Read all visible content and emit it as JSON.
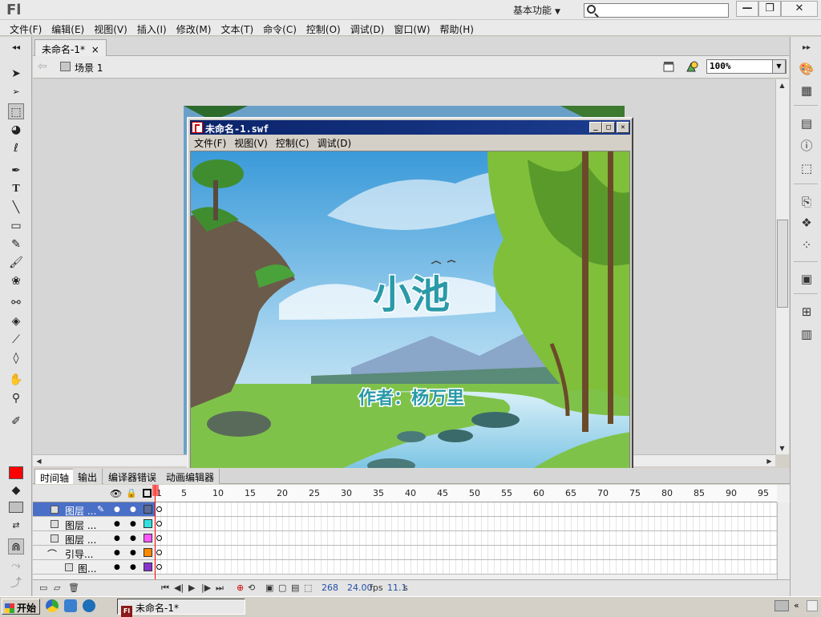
{
  "app": {
    "logo": "Fl",
    "workspace": "基本功能",
    "search_placeholder": ""
  },
  "window_buttons": {
    "minimize": "—",
    "restore": "❐",
    "close": "✕"
  },
  "menu": [
    "文件(F)",
    "编辑(E)",
    "视图(V)",
    "插入(I)",
    "修改(M)",
    "文本(T)",
    "命令(C)",
    "控制(O)",
    "调试(D)",
    "窗口(W)",
    "帮助(H)"
  ],
  "document": {
    "tab": "未命名-1*",
    "tab_close": "×",
    "scene": "场景 1",
    "zoom": "100%"
  },
  "swf_window": {
    "title": "未命名-1.swf",
    "menu": [
      "文件(F)",
      "视图(V)",
      "控制(C)",
      "调试(D)"
    ],
    "buttons": {
      "minimize": "_",
      "maximize": "□",
      "close": "✕"
    },
    "heading": "小池",
    "author": "作者：杨万里"
  },
  "panel_tabs": [
    "时间轴",
    "输出",
    "编译器错误",
    "动画编辑器"
  ],
  "timeline": {
    "frame_numbers": [
      "1",
      "5",
      "10",
      "15",
      "20",
      "25",
      "30",
      "35",
      "40",
      "45",
      "50",
      "55",
      "60",
      "65",
      "70",
      "75",
      "80",
      "85",
      "90",
      "95"
    ],
    "layers": [
      {
        "name": "图层 ...",
        "color": "#5a6a9a",
        "selected": true
      },
      {
        "name": "图层 ...",
        "color": "#33e0e0",
        "selected": false
      },
      {
        "name": "图层 ...",
        "color": "#ff55ff",
        "selected": false
      },
      {
        "name": "引导...",
        "color": "#ff8800",
        "selected": false
      },
      {
        "name": "图...",
        "color": "#8833cc",
        "selected": false
      }
    ],
    "status": {
      "frame": "268",
      "fps": "24.00",
      "fps_unit": "fps",
      "time": "11.1",
      "time_unit": "s"
    }
  },
  "taskbar": {
    "start": "开始",
    "task": "未命名-1*"
  },
  "colors": {
    "stroke": "#ff0000",
    "selected_layer": "#4a6fc7",
    "swf_title": "#0a246a"
  }
}
